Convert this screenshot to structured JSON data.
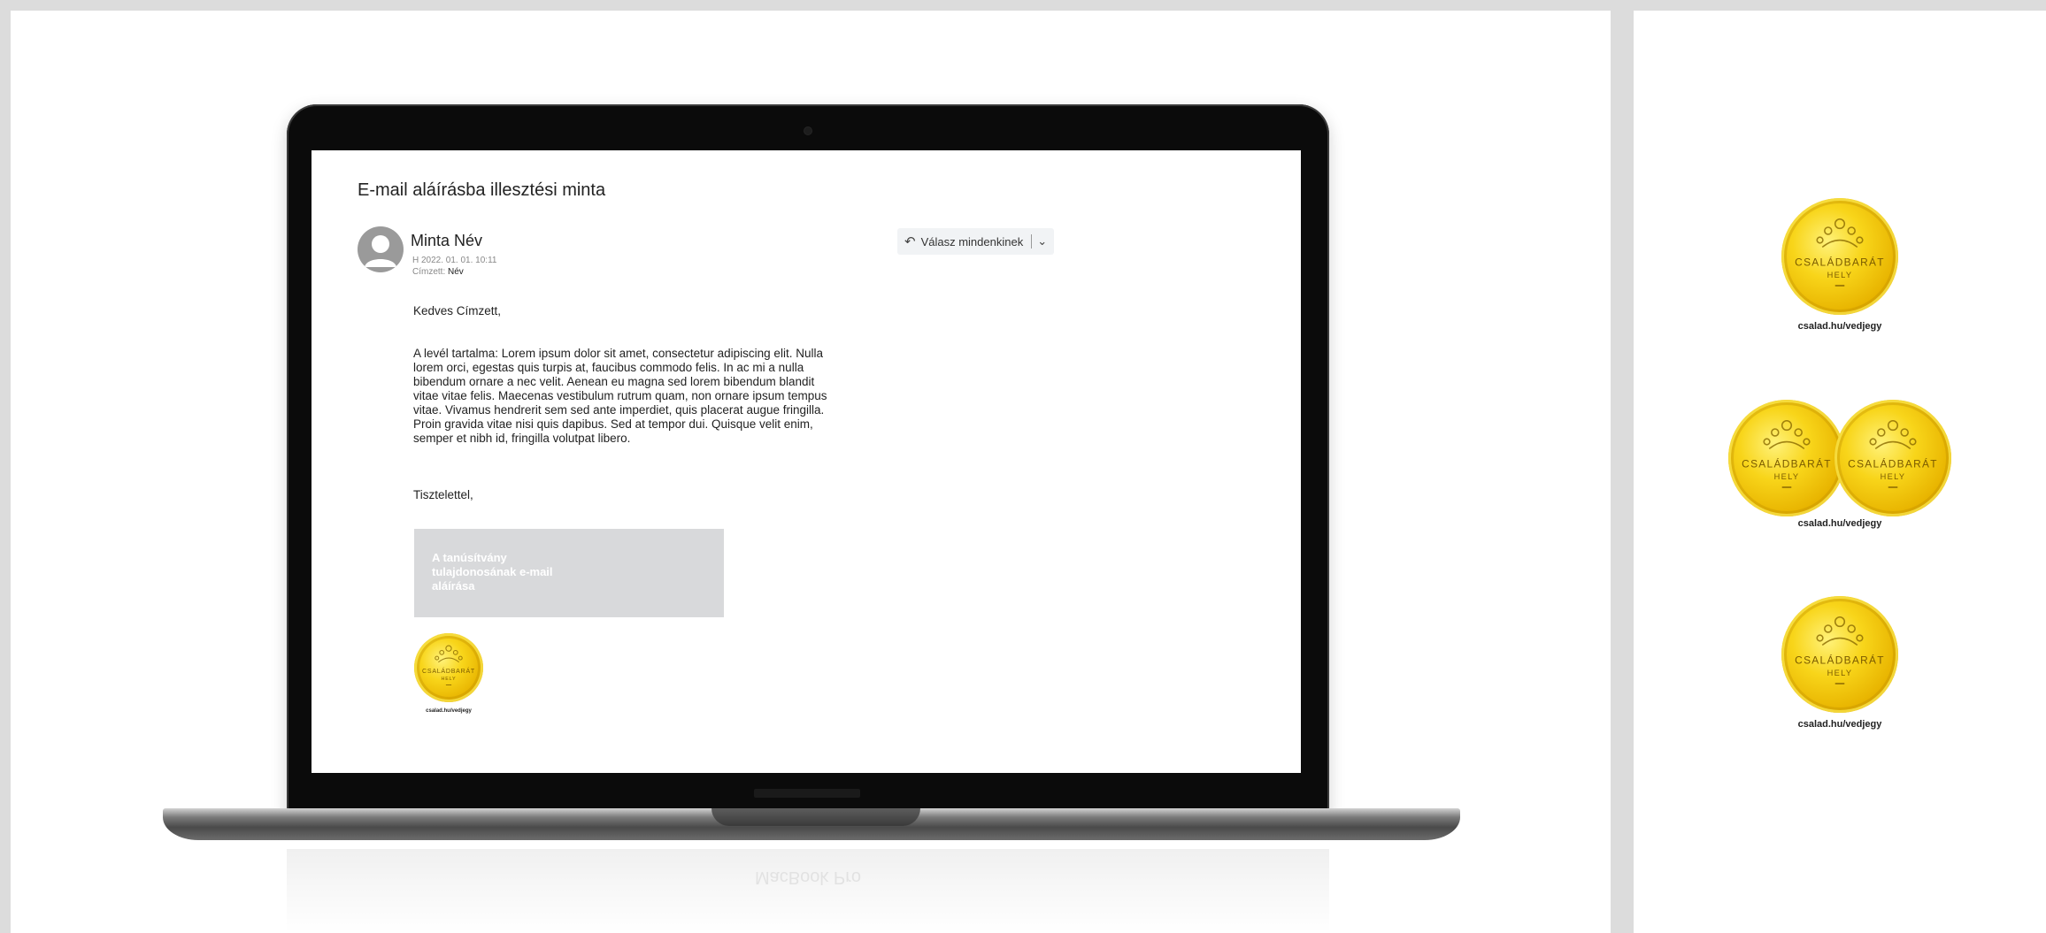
{
  "email": {
    "subject": "E-mail aláírásba illesztési minta",
    "sender_name": "Minta Név",
    "date": "H 2022. 01. 01. 10:11",
    "recipient_label": "Címzett:",
    "recipient_name": "Név",
    "reply_all_label": "Válasz mindenkinek",
    "greeting": "Kedves Címzett,",
    "content": "A levél tartalma: Lorem ipsum dolor sit amet, consectetur adipiscing elit. Nulla lorem orci, egestas quis turpis at, faucibus commodo felis. In ac mi a nulla bibendum ornare a nec velit. Aenean eu magna sed lorem bibendum blandit vitae vitae felis. Maecenas vestibulum rutrum quam, non ornare ipsum tempus vitae. Vivamus hendrerit sem sed ante imperdiet, quis placerat augue fringilla. Proin gravida vitae nisi quis dapibus. Sed at tempor dui. Quisque velit enim, semper et nibh id, fringilla volutpat libero.",
    "closing": "Tisztelettel,",
    "signature_text": "A tanúsítvány tulajdonosának e-mail aláírása",
    "medal_caption": "csalad.hu/vedjegy"
  },
  "laptop": {
    "brand_reflection": "MacBook Pro"
  },
  "medal": {
    "line1": "CSALÁDBARÁT",
    "line2": "HELY"
  },
  "side": {
    "caption_1": "csalad.hu/vedjegy",
    "caption_2": "csalad.hu/vedjegy",
    "caption_3": "csalad.hu/vedjegy"
  },
  "colors": {
    "gold": "#f8d51a",
    "signature_box": "#d8d9db",
    "page_bg": "#dcdcdc"
  }
}
